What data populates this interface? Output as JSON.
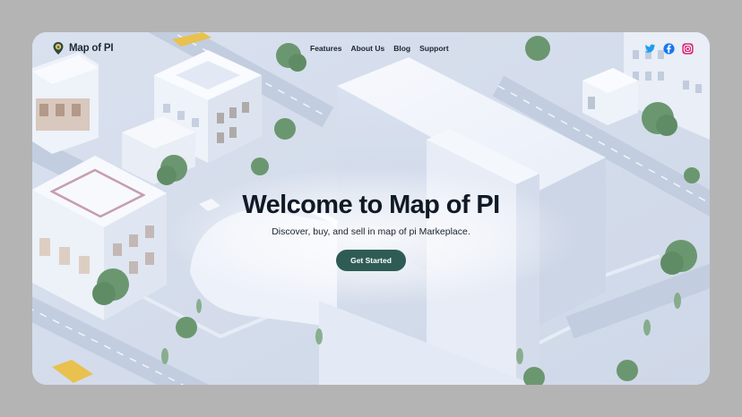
{
  "brand": {
    "name": "Map of PI",
    "logo_icon": "map-pin-icon"
  },
  "nav": {
    "links": [
      {
        "label": "Features"
      },
      {
        "label": "About Us"
      },
      {
        "label": "Blog"
      },
      {
        "label": "Support"
      }
    ]
  },
  "socials": [
    {
      "name": "twitter-icon",
      "color": "#1d9bf0"
    },
    {
      "name": "facebook-icon",
      "color": "#1877f2"
    },
    {
      "name": "instagram-icon",
      "color": "#d62976"
    }
  ],
  "hero": {
    "title": "Welcome to Map of PI",
    "subtitle": "Discover, buy, and sell in map of pi Markeplace.",
    "cta_label": "Get Started",
    "cta_color": "#2e5c55"
  },
  "background": {
    "image": "isometric-city-background"
  }
}
